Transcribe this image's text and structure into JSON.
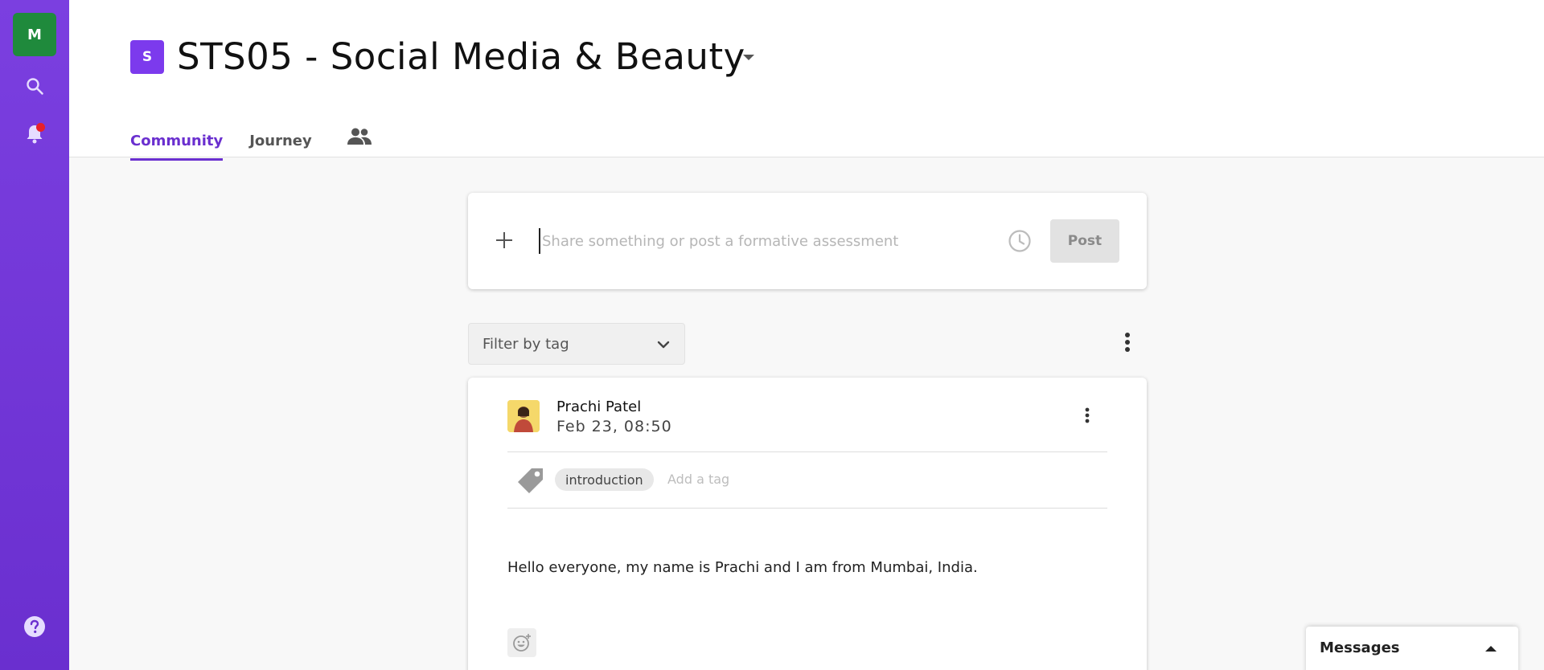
{
  "sidebar": {
    "user_initial": "M",
    "icons": [
      "search-icon",
      "bell-icon",
      "help-icon"
    ]
  },
  "header": {
    "course_badge": "S",
    "course_title": "STS05 - Social Media & Beauty",
    "tabs": [
      {
        "label": "Community",
        "active": true
      },
      {
        "label": "Journey",
        "active": false
      }
    ],
    "people_icon": "people-icon"
  },
  "composer": {
    "placeholder": "Share something or post a formative assessment",
    "post_label": "Post"
  },
  "filter": {
    "label": "Filter by tag"
  },
  "post": {
    "author": "Prachi Patel",
    "date": "Feb 23, 08:50",
    "tags": [
      "introduction"
    ],
    "add_tag_placeholder": "Add a tag",
    "body": "Hello everyone, my name is Prachi and I am from Mumbai, India."
  },
  "messages": {
    "label": "Messages"
  },
  "colors": {
    "sidebar": "#6a2fcf",
    "accent": "#6a2fcf",
    "user_avatar": "#1f8a3c",
    "course_badge": "#7c3aed",
    "notification_dot": "#e8202a"
  }
}
